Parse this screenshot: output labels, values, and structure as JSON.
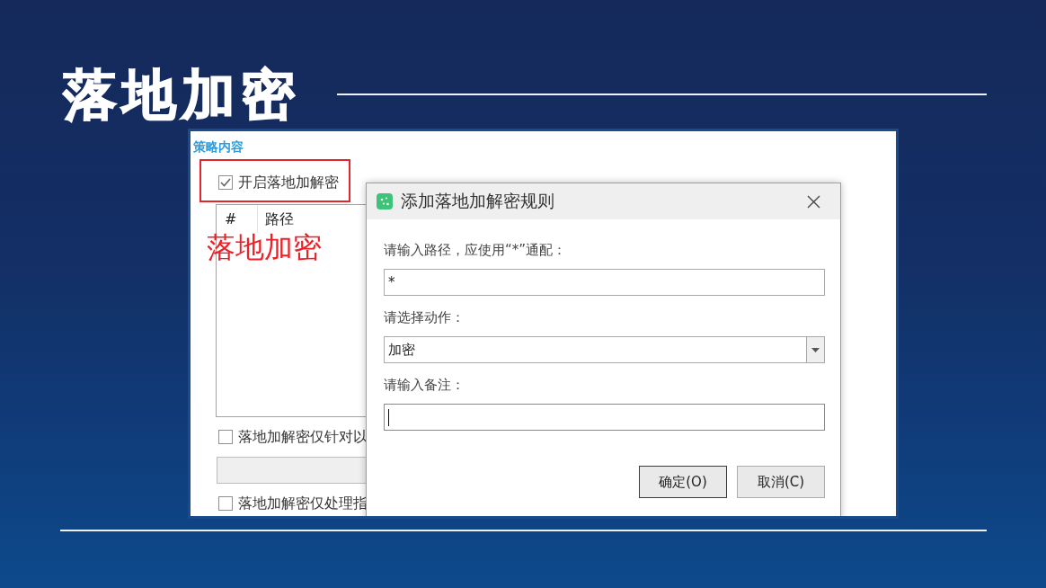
{
  "slide": {
    "title": "落地加密"
  },
  "panel": {
    "section_title": "策略内容",
    "enable_checkbox": {
      "label": "开启落地加解密",
      "checked": true,
      "highlighted": true
    },
    "rules_table": {
      "columns": [
        "#",
        "路径"
      ]
    },
    "annotation": "落地加密",
    "options": [
      {
        "kind": "checkbox",
        "label": "落地加解密仅针对以",
        "checked": false
      },
      {
        "kind": "field",
        "disabled": true
      },
      {
        "kind": "checkbox",
        "label": "落地加解密仅处理指",
        "checked": false
      }
    ]
  },
  "dialog": {
    "title": "添加落地加解密规则",
    "fields": [
      {
        "kind": "text",
        "label": "请输入路径，应使用“*”通配：",
        "value": "*",
        "focused": false
      },
      {
        "kind": "select",
        "label": "请选择动作：",
        "value": "加密",
        "focused": false
      },
      {
        "kind": "text",
        "label": "请输入备注：",
        "focused": true
      }
    ],
    "buttons": [
      {
        "label": "确定(O)",
        "default": true
      },
      {
        "label": "取消(C)",
        "default": false
      }
    ]
  }
}
